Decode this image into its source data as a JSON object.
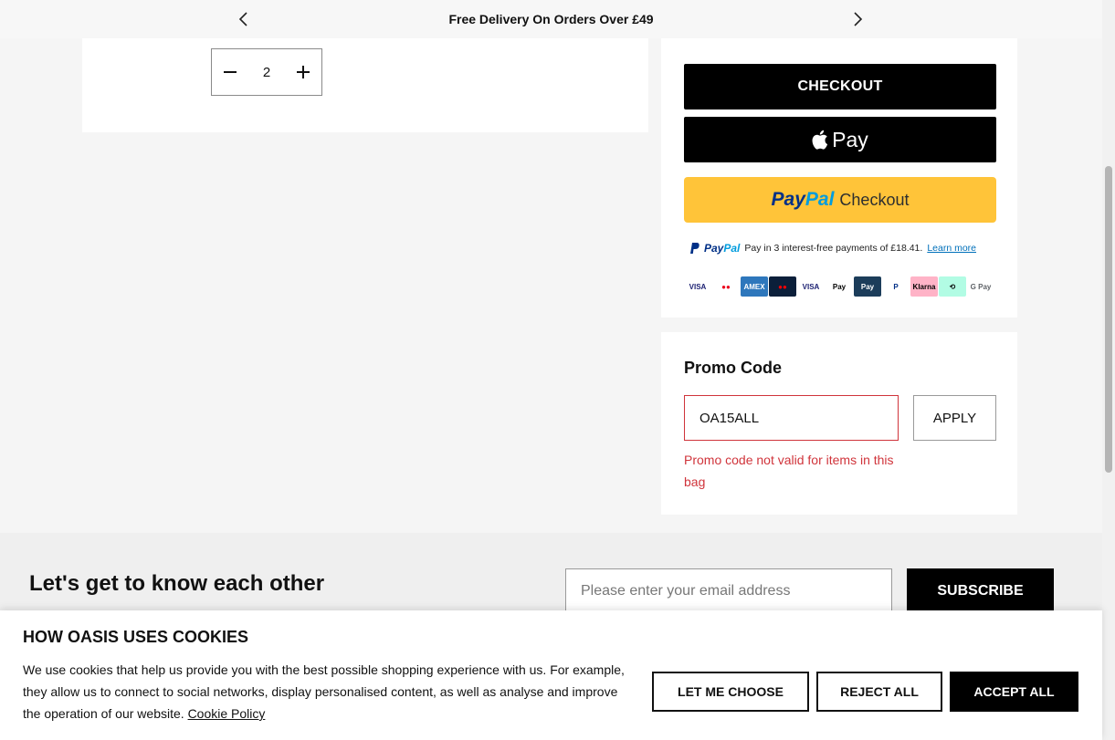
{
  "topbar": {
    "message": "Free Delivery On Orders Over £49",
    "prev_icon": "chevron-left-icon",
    "next_icon": "chevron-right-icon"
  },
  "cart": {
    "quantity": "2"
  },
  "checkout": {
    "checkout_label": "CHECKOUT",
    "applepay_label": "Pay",
    "paypal_brand_1": "Pay",
    "paypal_brand_2": "Pal",
    "paypal_checkout_label": "Checkout",
    "paylater_text": "Pay in 3 interest-free payments of £18.41.",
    "paylater_link": "Learn more",
    "payment_methods": [
      {
        "label": "VISA",
        "bg": "#ffffff",
        "fg": "#1a1f71"
      },
      {
        "label": "●●",
        "bg": "#ffffff",
        "fg": "#eb001b"
      },
      {
        "label": "AMEX",
        "bg": "#2e77bc",
        "fg": "#ffffff"
      },
      {
        "label": "●●",
        "bg": "#0b1f3a",
        "fg": "#ff0000"
      },
      {
        "label": "VISA",
        "bg": "#ffffff",
        "fg": "#1a1f71"
      },
      {
        "label": "Pay",
        "bg": "#ffffff",
        "fg": "#000000"
      },
      {
        "label": "Pay",
        "bg": "#1c3d5a",
        "fg": "#ffffff"
      },
      {
        "label": "P",
        "bg": "#ffffff",
        "fg": "#003087"
      },
      {
        "label": "Klarna",
        "bg": "#ffb3c7",
        "fg": "#000000"
      },
      {
        "label": "⟲",
        "bg": "#b2fce4",
        "fg": "#000000"
      },
      {
        "label": "G Pay",
        "bg": "#ffffff",
        "fg": "#5f6368"
      }
    ]
  },
  "promo": {
    "title": "Promo Code",
    "code_value": "OA15ALL",
    "apply_label": "APPLY",
    "error": "Promo code not valid for items in this bag"
  },
  "newsletter": {
    "title": "Let's get to know each other",
    "email_placeholder": "Please enter your email address",
    "subscribe_label": "SUBSCRIBE"
  },
  "cookies": {
    "title": "HOW OASIS USES COOKIES",
    "text": "We use cookies that help us provide you with the best possible shopping experience with us. For example, they allow us to connect to social networks, display personalised content, as well as analyse and improve the operation of our website.",
    "policy_link": "Cookie Policy",
    "choose_label": "LET ME CHOOSE",
    "reject_label": "REJECT ALL",
    "accept_label": "ACCEPT ALL"
  },
  "colors": {
    "error": "#d0343b",
    "paypal_yellow": "#ffc439",
    "black": "#000000"
  }
}
